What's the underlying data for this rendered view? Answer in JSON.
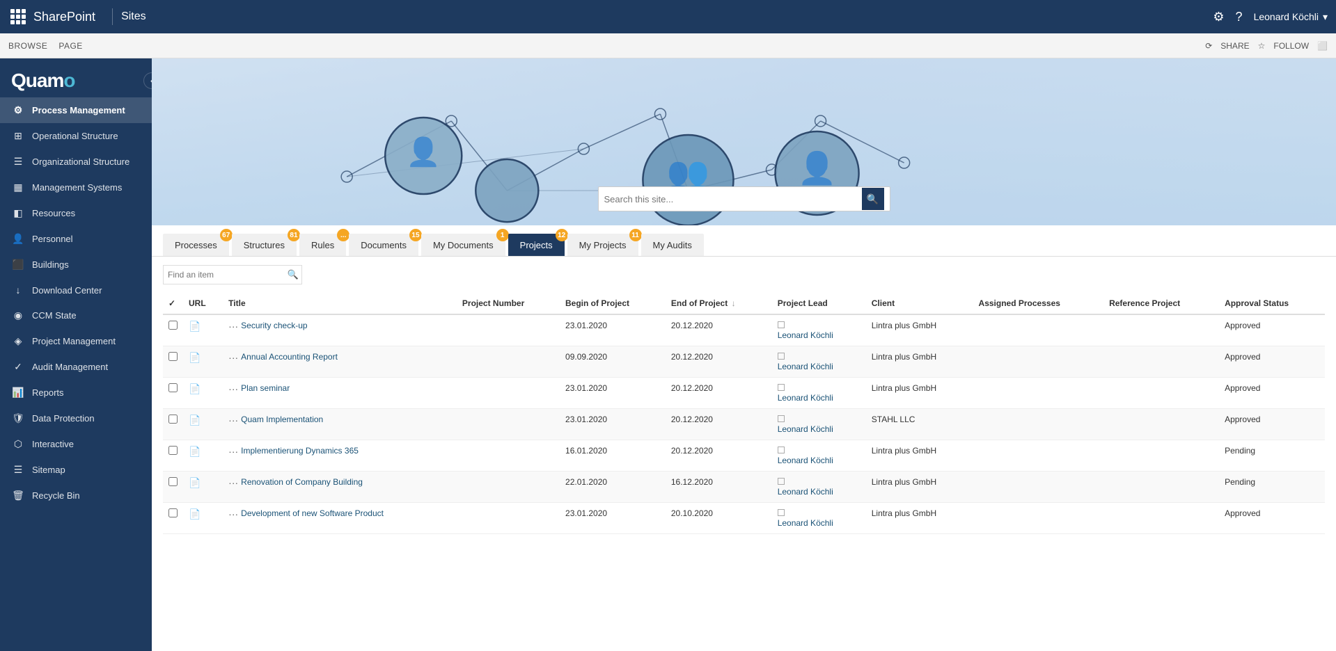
{
  "topbar": {
    "brand": "SharePoint",
    "divider": "|",
    "sites": "Sites",
    "user": "Leonard Köchli",
    "chevron": "▾"
  },
  "secondbar": {
    "browse": "BROWSE",
    "page": "PAGE",
    "share": "SHARE",
    "follow": "FOLLOW"
  },
  "sidebar": {
    "logo": "Quamo",
    "items": [
      {
        "id": "process-management",
        "label": "Process Management",
        "icon": "⚙",
        "active": true
      },
      {
        "id": "operational-structure",
        "label": "Operational Structure",
        "icon": "⊞"
      },
      {
        "id": "organizational-structure",
        "label": "Organizational Structure",
        "icon": "☰"
      },
      {
        "id": "management-systems",
        "label": "Management Systems",
        "icon": "▦"
      },
      {
        "id": "resources",
        "label": "Resources",
        "icon": "◧"
      },
      {
        "id": "personnel",
        "label": "Personnel",
        "icon": "👤"
      },
      {
        "id": "buildings",
        "label": "Buildings",
        "icon": "⬛"
      },
      {
        "id": "download-center",
        "label": "Download Center",
        "icon": "↓"
      },
      {
        "id": "ccm-state",
        "label": "CCM State",
        "icon": "◉"
      },
      {
        "id": "project-management",
        "label": "Project Management",
        "icon": "◈"
      },
      {
        "id": "audit-management",
        "label": "Audit Management",
        "icon": "✓"
      },
      {
        "id": "reports",
        "label": "Reports",
        "icon": "📊"
      },
      {
        "id": "data-protection",
        "label": "Data Protection",
        "icon": "🛡"
      },
      {
        "id": "interactive",
        "label": "Interactive",
        "icon": "⬡"
      },
      {
        "id": "sitemap",
        "label": "Sitemap",
        "icon": "☰"
      },
      {
        "id": "recycle-bin",
        "label": "Recycle Bin",
        "icon": "🗑"
      }
    ]
  },
  "hero": {
    "search_placeholder": "Search this site..."
  },
  "tabs": [
    {
      "id": "processes",
      "label": "Processes",
      "badge": "67",
      "active": false
    },
    {
      "id": "structures",
      "label": "Structures",
      "badge": "81",
      "active": false
    },
    {
      "id": "rules",
      "label": "Rules",
      "badge": "...",
      "active": false
    },
    {
      "id": "documents",
      "label": "Documents",
      "badge": "15",
      "active": false
    },
    {
      "id": "my-documents",
      "label": "My Documents",
      "badge": "1",
      "active": false
    },
    {
      "id": "projects",
      "label": "Projects",
      "badge": "12",
      "active": true
    },
    {
      "id": "my-projects",
      "label": "My Projects",
      "badge": "11",
      "active": false
    },
    {
      "id": "my-audits",
      "label": "My Audits",
      "badge": "",
      "active": false
    }
  ],
  "list": {
    "search_placeholder": "Find an item",
    "columns": {
      "check": "",
      "url": "URL",
      "title": "Title",
      "project_number": "Project Number",
      "begin_of_project": "Begin of Project",
      "end_of_project": "End of Project",
      "project_lead": "Project Lead",
      "client": "Client",
      "assigned_processes": "Assigned Processes",
      "reference_project": "Reference Project",
      "approval_status": "Approval Status"
    },
    "rows": [
      {
        "title": "Security check-up",
        "project_number": "",
        "begin_of_project": "23.01.2020",
        "end_of_project": "20.12.2020",
        "project_lead": "Leonard Köchli",
        "client": "Lintra plus GmbH",
        "assigned_processes": "",
        "reference_project": "",
        "approval_status": "Approved",
        "alt": false
      },
      {
        "title": "Annual Accounting Report",
        "project_number": "",
        "begin_of_project": "09.09.2020",
        "end_of_project": "20.12.2020",
        "project_lead": "Leonard Köchli",
        "client": "Lintra plus GmbH",
        "assigned_processes": "",
        "reference_project": "",
        "approval_status": "Approved",
        "alt": true
      },
      {
        "title": "Plan seminar",
        "project_number": "",
        "begin_of_project": "23.01.2020",
        "end_of_project": "20.12.2020",
        "project_lead": "Leonard Köchli",
        "client": "Lintra plus GmbH",
        "assigned_processes": "",
        "reference_project": "",
        "approval_status": "Approved",
        "alt": false
      },
      {
        "title": "Quam Implementation",
        "project_number": "",
        "begin_of_project": "23.01.2020",
        "end_of_project": "20.12.2020",
        "project_lead": "Leonard Köchli",
        "client": "STAHL LLC",
        "assigned_processes": "",
        "reference_project": "",
        "approval_status": "Approved",
        "alt": true
      },
      {
        "title": "Implementierung Dynamics 365",
        "project_number": "",
        "begin_of_project": "16.01.2020",
        "end_of_project": "20.12.2020",
        "project_lead": "Leonard Köchli",
        "client": "Lintra plus GmbH",
        "assigned_processes": "",
        "reference_project": "",
        "approval_status": "Pending",
        "alt": false
      },
      {
        "title": "Renovation of Company Building",
        "project_number": "",
        "begin_of_project": "22.01.2020",
        "end_of_project": "16.12.2020",
        "project_lead": "Leonard Köchli",
        "client": "Lintra plus GmbH",
        "assigned_processes": "",
        "reference_project": "",
        "approval_status": "Pending",
        "alt": true
      },
      {
        "title": "Development of new Software Product",
        "project_number": "",
        "begin_of_project": "23.01.2020",
        "end_of_project": "20.10.2020",
        "project_lead": "Leonard Köchli",
        "client": "Lintra plus GmbH",
        "assigned_processes": "",
        "reference_project": "",
        "approval_status": "Approved",
        "alt": false
      }
    ]
  },
  "colors": {
    "sidebar_bg": "#1e3a5f",
    "accent": "#f5a623",
    "active_tab": "#1e3a5f",
    "link": "#1a5276"
  }
}
